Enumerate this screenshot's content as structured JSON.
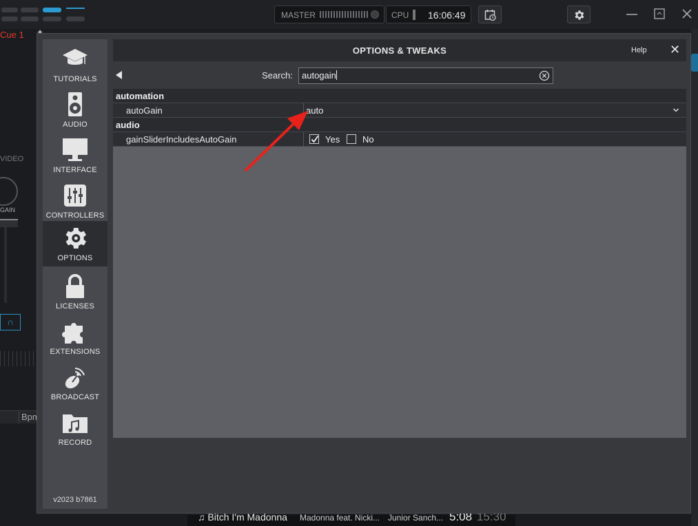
{
  "topbar": {
    "master_label": "MASTER",
    "cpu_label": "CPU",
    "clock": "16:06:49"
  },
  "background": {
    "cue_label": "Cue 1",
    "video_label": "VIDEO",
    "gain_label": "GAIN",
    "bpm_header": "Bpm",
    "now_playing": {
      "title": "Bitch I'm Madonna",
      "artist": "Madonna feat. Nicki...",
      "remix": "Junior Sanch...",
      "length": "5:08",
      "elapsed": "15:30"
    }
  },
  "dialog": {
    "title": "OPTIONS & TWEAKS",
    "help_label": "Help",
    "close_label": "✕",
    "version": "v2023 b7861",
    "search": {
      "label": "Search:",
      "value": "autogain"
    },
    "sidebar": {
      "items": [
        {
          "label": "TUTORIALS",
          "icon": "graduation-cap-icon"
        },
        {
          "label": "AUDIO",
          "icon": "speaker-icon"
        },
        {
          "label": "INTERFACE",
          "icon": "monitor-icon"
        },
        {
          "label": "CONTROLLERS",
          "icon": "mixer-sliders-icon"
        },
        {
          "label": "OPTIONS",
          "icon": "gear-icon",
          "active": true
        },
        {
          "label": "LICENSES",
          "icon": "lock-icon"
        },
        {
          "label": "EXTENSIONS",
          "icon": "puzzle-icon"
        },
        {
          "label": "BROADCAST",
          "icon": "satellite-dish-icon"
        },
        {
          "label": "RECORD",
          "icon": "music-folder-icon"
        }
      ]
    },
    "results": [
      {
        "category": "automation"
      },
      {
        "name": "autoGain",
        "value": "auto",
        "type": "dropdown"
      },
      {
        "category": "audio"
      },
      {
        "name": "gainSliderIncludesAutoGain",
        "type": "yesno",
        "yes_label": "Yes",
        "no_label": "No",
        "selected": "Yes"
      }
    ]
  },
  "colors": {
    "accent_blue": "#2b9bd0",
    "cue_red": "#e23a2c",
    "annotation_arrow": "#e8221b"
  }
}
